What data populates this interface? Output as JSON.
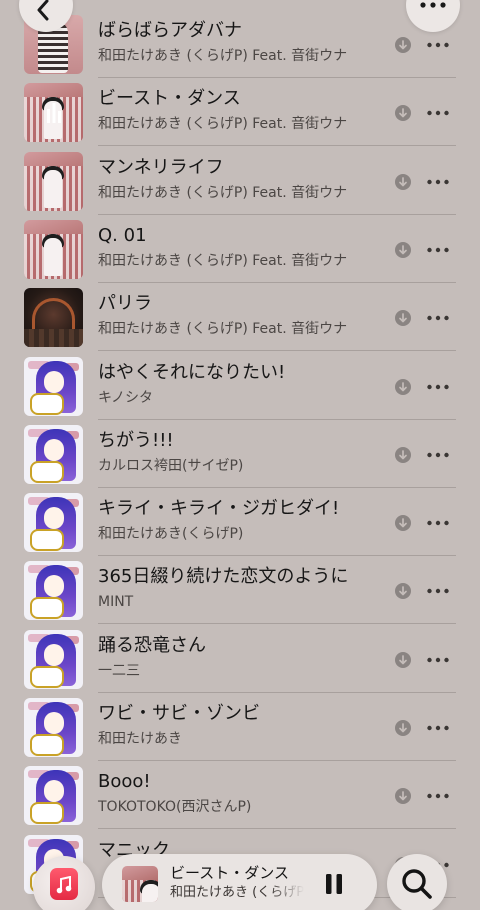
{
  "colors": {
    "background": "#c5bdba",
    "accent": "#e42b44"
  },
  "songs": [
    {
      "title": "ばらばらアダバナ",
      "artist": "和田たけあき (くらげP) Feat. 音街ウナ",
      "art": "skeleton"
    },
    {
      "title": "ビースト・ダンス",
      "artist": "和田たけあき (くらげP) Feat. 音街ウナ",
      "art": "red",
      "now_playing": true
    },
    {
      "title": "マンネリライフ",
      "artist": "和田たけあき (くらげP) Feat. 音街ウナ",
      "art": "red"
    },
    {
      "title": "Q. 01",
      "artist": "和田たけあき (くらげP) Feat. 音街ウナ",
      "art": "red"
    },
    {
      "title": "パリラ",
      "artist": "和田たけあき (くらげP) Feat. 音街ウナ",
      "art": "dark"
    },
    {
      "title": "はやくそれになりたい!",
      "artist": "キノシタ",
      "art": "anime"
    },
    {
      "title": "ちがう!!!",
      "artist": "カルロス袴田(サイゼP)",
      "art": "anime"
    },
    {
      "title": "キライ・キライ・ジガヒダイ!",
      "artist": "和田たけあき(くらげP)",
      "art": "anime"
    },
    {
      "title": "365日綴り続けた恋文のように",
      "artist": "MINT",
      "art": "anime"
    },
    {
      "title": "踊る恐竜さん",
      "artist": "一二三",
      "art": "anime"
    },
    {
      "title": "ワビ・サビ・ゾンビ",
      "artist": "和田たけあき",
      "art": "anime"
    },
    {
      "title": "Booo!",
      "artist": "TOKOTOKO(西沢さんP)",
      "art": "anime"
    },
    {
      "title": "マニック",
      "artist": "",
      "art": "anime"
    }
  ],
  "icons": {
    "back": "chevron-left-icon",
    "more": "ellipsis-icon",
    "download": "download-icon",
    "music_app": "music-note-icon",
    "pause": "pause-icon",
    "search": "search-icon"
  },
  "mini_player": {
    "title": "ビースト・ダンス",
    "artist": "和田たけあき (くらげP) Feat. 音街ウナ"
  }
}
